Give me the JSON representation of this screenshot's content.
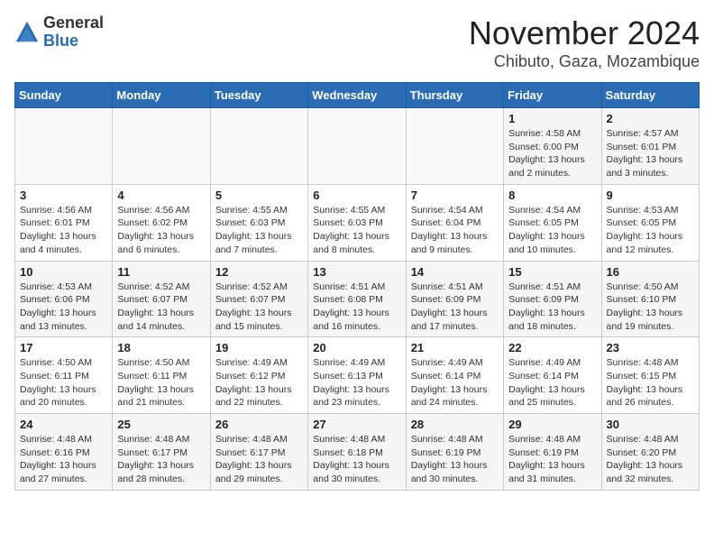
{
  "logo": {
    "general": "General",
    "blue": "Blue"
  },
  "title": {
    "month": "November 2024",
    "location": "Chibuto, Gaza, Mozambique"
  },
  "headers": [
    "Sunday",
    "Monday",
    "Tuesday",
    "Wednesday",
    "Thursday",
    "Friday",
    "Saturday"
  ],
  "rows": [
    [
      {
        "day": "",
        "info": ""
      },
      {
        "day": "",
        "info": ""
      },
      {
        "day": "",
        "info": ""
      },
      {
        "day": "",
        "info": ""
      },
      {
        "day": "",
        "info": ""
      },
      {
        "day": "1",
        "info": "Sunrise: 4:58 AM\nSunset: 6:00 PM\nDaylight: 13 hours and 2 minutes."
      },
      {
        "day": "2",
        "info": "Sunrise: 4:57 AM\nSunset: 6:01 PM\nDaylight: 13 hours and 3 minutes."
      }
    ],
    [
      {
        "day": "3",
        "info": "Sunrise: 4:56 AM\nSunset: 6:01 PM\nDaylight: 13 hours and 4 minutes."
      },
      {
        "day": "4",
        "info": "Sunrise: 4:56 AM\nSunset: 6:02 PM\nDaylight: 13 hours and 6 minutes."
      },
      {
        "day": "5",
        "info": "Sunrise: 4:55 AM\nSunset: 6:03 PM\nDaylight: 13 hours and 7 minutes."
      },
      {
        "day": "6",
        "info": "Sunrise: 4:55 AM\nSunset: 6:03 PM\nDaylight: 13 hours and 8 minutes."
      },
      {
        "day": "7",
        "info": "Sunrise: 4:54 AM\nSunset: 6:04 PM\nDaylight: 13 hours and 9 minutes."
      },
      {
        "day": "8",
        "info": "Sunrise: 4:54 AM\nSunset: 6:05 PM\nDaylight: 13 hours and 10 minutes."
      },
      {
        "day": "9",
        "info": "Sunrise: 4:53 AM\nSunset: 6:05 PM\nDaylight: 13 hours and 12 minutes."
      }
    ],
    [
      {
        "day": "10",
        "info": "Sunrise: 4:53 AM\nSunset: 6:06 PM\nDaylight: 13 hours and 13 minutes."
      },
      {
        "day": "11",
        "info": "Sunrise: 4:52 AM\nSunset: 6:07 PM\nDaylight: 13 hours and 14 minutes."
      },
      {
        "day": "12",
        "info": "Sunrise: 4:52 AM\nSunset: 6:07 PM\nDaylight: 13 hours and 15 minutes."
      },
      {
        "day": "13",
        "info": "Sunrise: 4:51 AM\nSunset: 6:08 PM\nDaylight: 13 hours and 16 minutes."
      },
      {
        "day": "14",
        "info": "Sunrise: 4:51 AM\nSunset: 6:09 PM\nDaylight: 13 hours and 17 minutes."
      },
      {
        "day": "15",
        "info": "Sunrise: 4:51 AM\nSunset: 6:09 PM\nDaylight: 13 hours and 18 minutes."
      },
      {
        "day": "16",
        "info": "Sunrise: 4:50 AM\nSunset: 6:10 PM\nDaylight: 13 hours and 19 minutes."
      }
    ],
    [
      {
        "day": "17",
        "info": "Sunrise: 4:50 AM\nSunset: 6:11 PM\nDaylight: 13 hours and 20 minutes."
      },
      {
        "day": "18",
        "info": "Sunrise: 4:50 AM\nSunset: 6:11 PM\nDaylight: 13 hours and 21 minutes."
      },
      {
        "day": "19",
        "info": "Sunrise: 4:49 AM\nSunset: 6:12 PM\nDaylight: 13 hours and 22 minutes."
      },
      {
        "day": "20",
        "info": "Sunrise: 4:49 AM\nSunset: 6:13 PM\nDaylight: 13 hours and 23 minutes."
      },
      {
        "day": "21",
        "info": "Sunrise: 4:49 AM\nSunset: 6:14 PM\nDaylight: 13 hours and 24 minutes."
      },
      {
        "day": "22",
        "info": "Sunrise: 4:49 AM\nSunset: 6:14 PM\nDaylight: 13 hours and 25 minutes."
      },
      {
        "day": "23",
        "info": "Sunrise: 4:48 AM\nSunset: 6:15 PM\nDaylight: 13 hours and 26 minutes."
      }
    ],
    [
      {
        "day": "24",
        "info": "Sunrise: 4:48 AM\nSunset: 6:16 PM\nDaylight: 13 hours and 27 minutes."
      },
      {
        "day": "25",
        "info": "Sunrise: 4:48 AM\nSunset: 6:17 PM\nDaylight: 13 hours and 28 minutes."
      },
      {
        "day": "26",
        "info": "Sunrise: 4:48 AM\nSunset: 6:17 PM\nDaylight: 13 hours and 29 minutes."
      },
      {
        "day": "27",
        "info": "Sunrise: 4:48 AM\nSunset: 6:18 PM\nDaylight: 13 hours and 30 minutes."
      },
      {
        "day": "28",
        "info": "Sunrise: 4:48 AM\nSunset: 6:19 PM\nDaylight: 13 hours and 30 minutes."
      },
      {
        "day": "29",
        "info": "Sunrise: 4:48 AM\nSunset: 6:19 PM\nDaylight: 13 hours and 31 minutes."
      },
      {
        "day": "30",
        "info": "Sunrise: 4:48 AM\nSunset: 6:20 PM\nDaylight: 13 hours and 32 minutes."
      }
    ]
  ]
}
